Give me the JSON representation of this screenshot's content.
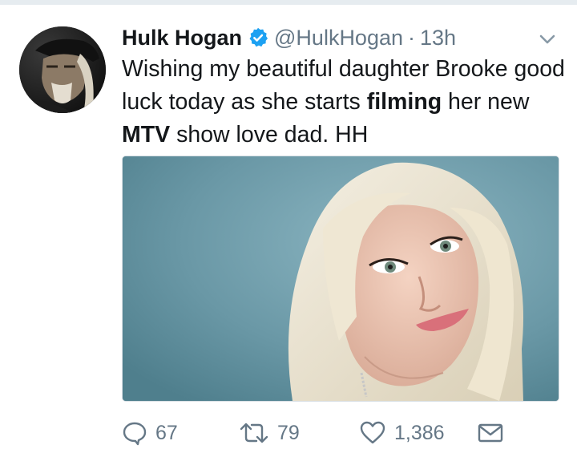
{
  "tweet": {
    "author_name": "Hulk Hogan",
    "handle": "@HulkHogan",
    "separator": "·",
    "time": "13h",
    "text_parts": {
      "p1": "Wishing my beautiful daughter Brooke good luck today as she starts ",
      "b1": "filming",
      "p2": " her new ",
      "b2": "MTV",
      "p3": " show love dad.    HH"
    }
  },
  "actions": {
    "replies": "67",
    "retweets": "79",
    "likes": "1,386"
  },
  "icons": {
    "verified": "verified-badge-icon",
    "menu": "chevron-down-icon",
    "reply": "reply-icon",
    "retweet": "retweet-icon",
    "like": "heart-icon",
    "dm": "envelope-icon"
  },
  "colors": {
    "text": "#14171a",
    "secondary": "#657786",
    "verified": "#1da1f2",
    "divider": "#e6ecf0"
  }
}
